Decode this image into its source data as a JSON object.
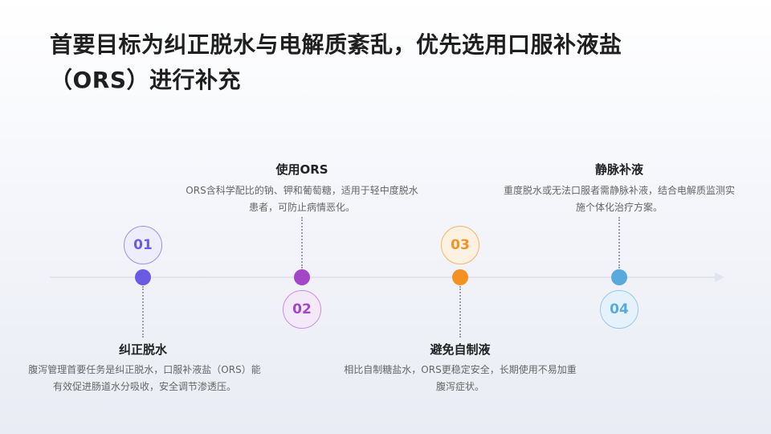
{
  "title": "首要目标为纠正脱水与电解质紊乱，优先选用口服补液盐（ORS）进行补充",
  "colors": {
    "step1": "#6a5be3",
    "step2": "#a346c8",
    "step3": "#f39220",
    "step4": "#5aa9de"
  },
  "steps": [
    {
      "number": "01",
      "title": "纠正脱水",
      "desc": "腹泻管理首要任务是纠正脱水，口服补液盐（ORS）能有效促进肠道水分吸收，安全调节渗透压。"
    },
    {
      "number": "02",
      "title": "使用ORS",
      "desc": "ORS含科学配比的钠、钾和葡萄糖，适用于轻中度脱水患者，可防止病情恶化。"
    },
    {
      "number": "03",
      "title": "避免自制液",
      "desc": "相比自制糖盐水，ORS更稳定安全，长期使用不易加重腹泻症状。"
    },
    {
      "number": "04",
      "title": "静脉补液",
      "desc": "重度脱水或无法口服者需静脉补液，结合电解质监测实施个体化治疗方案。"
    }
  ]
}
